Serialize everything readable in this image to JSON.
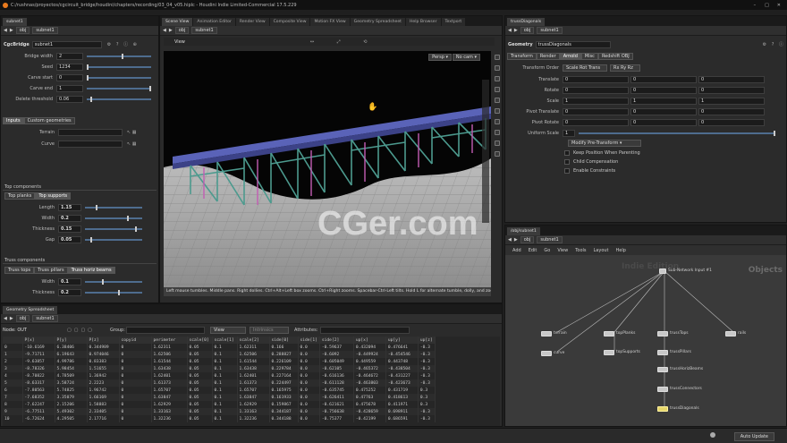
{
  "window": {
    "title": "C:/rushnas/proyectos/cgcircuit_bridge/houdini/chapters/recording/03_04_v05.hiplc - Houdini Indie Limited-Commercial 17.5.229",
    "controls": [
      "–",
      "□",
      "✕"
    ]
  },
  "left_params": {
    "tab": "subnet1",
    "path": "obj",
    "node_type": "CgcBridge",
    "node_name": "subnet1",
    "params": [
      {
        "label": "Bridge width",
        "value": "2",
        "fill": 0.55
      },
      {
        "label": "Seed",
        "value": "1234",
        "fill": 0
      },
      {
        "label": "Carve start",
        "value": "0",
        "fill": 0
      },
      {
        "label": "Carve end",
        "value": "1",
        "fill": 1
      },
      {
        "label": "Delete threshold",
        "value": "0.06",
        "fill": 0.06
      }
    ],
    "tabs1": [
      "Inputs",
      "Custom geometries"
    ],
    "inputs": [
      {
        "label": "Terrain",
        "value": ""
      },
      {
        "label": "Curve",
        "value": ""
      }
    ],
    "top_components": "Top components",
    "tabs2": [
      "Top planks",
      "Top supports"
    ],
    "top_params": [
      {
        "label": "Length",
        "value": "1.15",
        "fill": 0.2
      },
      {
        "label": "Width",
        "value": "0.2",
        "fill": 0.75
      },
      {
        "label": "Thickness",
        "value": "0.15",
        "fill": 0.9
      },
      {
        "label": "Gap",
        "value": "0.05",
        "fill": 0.1
      }
    ],
    "truss_components": "Truss components",
    "tabs3": [
      "Truss tops",
      "Truss pillars",
      "Truss horiz beams"
    ],
    "truss_params": [
      {
        "label": "Width",
        "value": "0.1",
        "fill": 0.3
      },
      {
        "label": "Thickness",
        "value": "0.2",
        "fill": 0.6
      }
    ]
  },
  "viewport": {
    "tabs": [
      "Scene View",
      "Animation Editor",
      "Render View",
      "Composite View",
      "Motion FX View",
      "Geometry Spreadsheet",
      "Help Browser",
      "Textport"
    ],
    "path": "obj",
    "node": "subnet1",
    "view_label": "View",
    "persp": "Persp ▾",
    "cam": "No cam ▾",
    "status": "Left mouse tumbles. Middle pans. Right dollies. Ctrl+Alt+Left box zooms. Ctrl+Right zooms. Spacebar-Ctrl-Left tilts. Hold L for alternate tumble, dolly, and zoom.",
    "watermark": "CGer.com"
  },
  "right_params": {
    "tab": "trussDiagonals",
    "path": "obj",
    "node": "subnet1",
    "node_type": "Geometry",
    "node_name": "trussDiagonals",
    "tabs": [
      "Transform",
      "Render",
      "Arnold",
      "Misc",
      "Redshift OBJ"
    ],
    "transform_order_label": "Transform Order",
    "transform_order": "Scale Rot Trans",
    "rot_order": "Rx Ry Rz",
    "rows": [
      {
        "label": "Translate",
        "vals": [
          "0",
          "0",
          "0"
        ]
      },
      {
        "label": "Rotate",
        "vals": [
          "0",
          "0",
          "0"
        ]
      },
      {
        "label": "Scale",
        "vals": [
          "1",
          "1",
          "1"
        ]
      },
      {
        "label": "Pivot Translate",
        "vals": [
          "0",
          "0",
          "0"
        ]
      },
      {
        "label": "Pivot Rotate",
        "vals": [
          "0",
          "0",
          "0"
        ]
      }
    ],
    "uniform_scale_label": "Uniform Scale",
    "uniform_scale": "1",
    "modify_btn": "Modify Pre-Transform ▾",
    "checks": [
      "Keep Position When Parenting",
      "Child Compensation",
      "Enable Constraints"
    ]
  },
  "spreadsheet": {
    "tab": "Geometry Spreadsheet",
    "path": "obj",
    "node": "subnet1",
    "node_label": "Node: OUT",
    "group_label": "Group:",
    "view_label": "View",
    "intrinsics": "Intrinsics",
    "attributes": "Attributes:",
    "columns": [
      "",
      "P[x]",
      "P[y]",
      "P[z]",
      "copyid",
      "perimeter",
      "scale[0]",
      "scale[1]",
      "scale[2]",
      "side[0]",
      "side[1]",
      "side[2]",
      "up[x]",
      "up[y]",
      "up[z]"
    ],
    "rows": [
      [
        "0",
        "-10.6169",
        "6.38406",
        "0.344989",
        "0",
        "1.62311",
        "0.05",
        "0.1",
        "1.62311",
        "0.166",
        "0.0",
        "-0.59637",
        "0.432094",
        "0.476641",
        "-0.3"
      ],
      [
        "1",
        "-9.71711",
        "6.19643",
        "0.974046",
        "0",
        "1.62506",
        "0.05",
        "0.1",
        "1.62506",
        "0.288827",
        "0.0",
        "-0.6092",
        "-0.449924",
        "-0.454546",
        "-0.3"
      ],
      [
        "2",
        "-9.63857",
        "4.99786",
        "0.83383",
        "0",
        "1.61544",
        "0.05",
        "0.1",
        "1.61544",
        "0.226109",
        "0.0",
        "-0.605049",
        "0.449559",
        "0.443748",
        "-0.3"
      ],
      [
        "3",
        "-8.78326",
        "5.98454",
        "1.51655",
        "0",
        "1.63438",
        "0.05",
        "0.1",
        "1.63438",
        "0.229784",
        "0.0",
        "-0.62105",
        "-0.465372",
        "-0.438504",
        "-0.3"
      ],
      [
        "4",
        "-8.70822",
        "4.78509",
        "1.36942",
        "0",
        "1.62401",
        "0.05",
        "0.1",
        "1.62401",
        "0.227164",
        "0.0",
        "-0.616136",
        "-0.464672",
        "-0.431227",
        "-0.3"
      ],
      [
        "5",
        "-8.63317",
        "3.58724",
        "2.2223",
        "0",
        "1.61373",
        "0.05",
        "0.1",
        "1.61373",
        "0.224497",
        "0.0",
        "-0.611128",
        "-0.463803",
        "-0.423673",
        "-0.3"
      ],
      [
        "6",
        "-7.80563",
        "5.74825",
        "1.96742",
        "0",
        "1.65707",
        "0.05",
        "0.1",
        "1.65707",
        "0.165975",
        "0.0",
        "-0.635745",
        "0.475252",
        "0.431719",
        "0.3"
      ],
      [
        "7",
        "-7.68352",
        "3.35079",
        "1.66169",
        "0",
        "1.63847",
        "0.05",
        "0.1",
        "1.63847",
        "0.161933",
        "0.0",
        "-0.626411",
        "0.47763",
        "0.418613",
        "0.3"
      ],
      [
        "8",
        "-7.62247",
        "2.15206",
        "1.58883",
        "0",
        "1.62929",
        "0.05",
        "0.1",
        "1.62929",
        "0.159867",
        "0.0",
        "-0.621621",
        "0.475678",
        "0.411971",
        "0.3"
      ],
      [
        "9",
        "-6.77511",
        "5.49302",
        "2.33405",
        "0",
        "1.33163",
        "0.05",
        "0.1",
        "1.33163",
        "0.344187",
        "0.0",
        "-0.756638",
        "-0.428659",
        "0.698911",
        "-0.3"
      ],
      [
        "10",
        "-6.72624",
        "4.29505",
        "2.17716",
        "0",
        "1.32236",
        "0.05",
        "0.1",
        "1.32236",
        "0.344188",
        "0.0",
        "-0.75377",
        "-0.42199",
        "0.686591",
        "-0.3"
      ]
    ]
  },
  "network": {
    "tab": "/obj/subnet1",
    "path": "obj",
    "node": "subnet1",
    "menu": [
      "Add",
      "Edit",
      "Go",
      "View",
      "Tools",
      "Layout",
      "Help"
    ],
    "badge_left": "Indie Edition",
    "badge_right": "Objects",
    "root": "Sub-Network Input #1",
    "nodes": [
      {
        "label": "terrain"
      },
      {
        "label": "curve"
      },
      {
        "label": "topPlanks"
      },
      {
        "label": "topSupports"
      },
      {
        "label": "trussTops"
      },
      {
        "label": "trussPillars"
      },
      {
        "label": "trussHorizBeams"
      },
      {
        "label": "trussConnectors"
      },
      {
        "label": "trussDiagonals"
      },
      {
        "label": "rails"
      }
    ]
  },
  "statusbar": {
    "auto_update": "Auto Update"
  }
}
